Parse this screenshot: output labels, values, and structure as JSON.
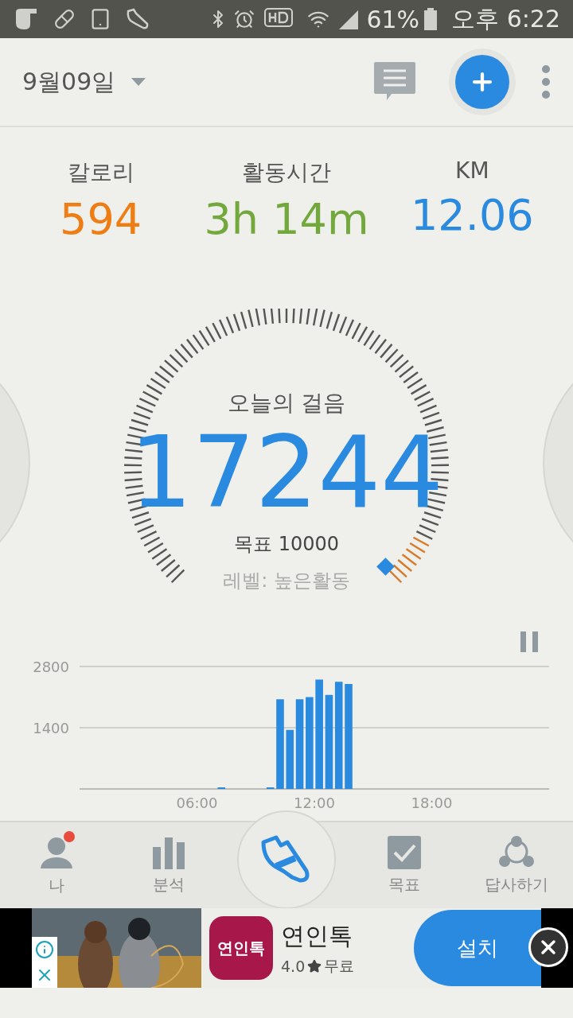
{
  "status_bar": {
    "battery": "61%",
    "time": "오후 6:22"
  },
  "header": {
    "date": "9월09일"
  },
  "stats": [
    {
      "label": "칼로리",
      "value": "594",
      "color": "#ee7d14"
    },
    {
      "label": "활동시간",
      "value": "3h 14m",
      "color": "#72a83c"
    },
    {
      "label": "KM",
      "value": "12.06",
      "color": "#2a8ae0"
    }
  ],
  "gauge": {
    "title": "오늘의 걸음",
    "steps": "17244",
    "goal": "목표 10000",
    "level_text": "레벨: 높은활동"
  },
  "chart": {
    "chart_data": {
      "type": "bar",
      "x": [
        7.25,
        9.75,
        10.25,
        10.75,
        11.25,
        11.75,
        12.25,
        12.75,
        13.25,
        13.75
      ],
      "values": [
        20,
        20,
        2050,
        1350,
        2050,
        2100,
        2500,
        2150,
        2450,
        2400
      ],
      "xlim": [
        0,
        24
      ],
      "ylim": [
        0,
        2800
      ],
      "xticks": [
        {
          "value": 6,
          "label": "06:00"
        },
        {
          "value": 12,
          "label": "12:00"
        },
        {
          "value": 18,
          "label": "18:00"
        }
      ],
      "yticks": [
        1400,
        2800
      ]
    }
  },
  "nav": [
    {
      "kind": "person",
      "label": "나",
      "badge": true,
      "selected": false
    },
    {
      "kind": "bars",
      "label": "분석",
      "badge": false,
      "selected": false
    },
    {
      "kind": "shoe",
      "badge": false,
      "selected": true
    },
    {
      "kind": "check",
      "label": "목표",
      "badge": false,
      "selected": false
    },
    {
      "kind": "share",
      "label": "답사하기",
      "badge": false,
      "selected": false
    }
  ],
  "ad": {
    "icon_label": "연인톡",
    "app_name": "연인톡",
    "rating": "4.0",
    "price": "무료",
    "install": "설치"
  }
}
